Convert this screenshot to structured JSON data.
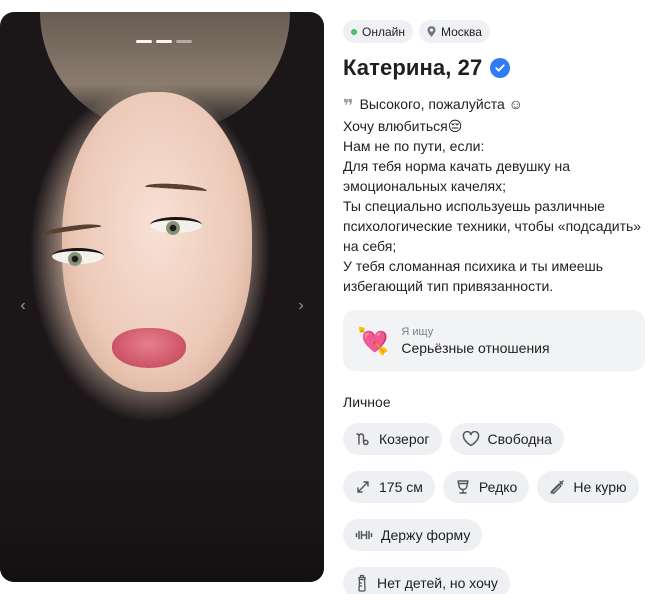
{
  "profile": {
    "status": "Онлайн",
    "city": "Москва",
    "name_age": "Катерина, 27",
    "bio": "Высокого, пожалуйста ☺\nХочу влюбиться😔\nНам не по пути, если:\nДля тебя норма качать девушку на эмоциональных качелях;\nТы специально используешь различные психологические техники, чтобы «подсадить» на себя;\nУ тебя сломанная психика и ты имеешь избегающий тип привязанности."
  },
  "looking_for": {
    "label": "Я ищу",
    "value": "Серьёзные отношения",
    "emoji": "💘"
  },
  "personal": {
    "title": "Личное",
    "tags": [
      {
        "icon": "capricorn-icon",
        "label": "Козерог"
      },
      {
        "icon": "heart-outline-icon",
        "label": "Свободна"
      },
      {
        "icon": "height-arrows-icon",
        "label": "175 см"
      },
      {
        "icon": "wine-glass-icon",
        "label": "Редко"
      },
      {
        "icon": "no-smoking-icon",
        "label": "Не курю"
      },
      {
        "icon": "dumbbell-icon",
        "label": "Держу форму"
      },
      {
        "icon": "baby-bottle-icon",
        "label": "Нет детей, но хочу"
      }
    ]
  },
  "photo": {
    "total": 3,
    "current": 1
  },
  "colors": {
    "online": "#3cc36b",
    "verified": "#2f7cf6",
    "chip_bg": "#eef0f3"
  }
}
